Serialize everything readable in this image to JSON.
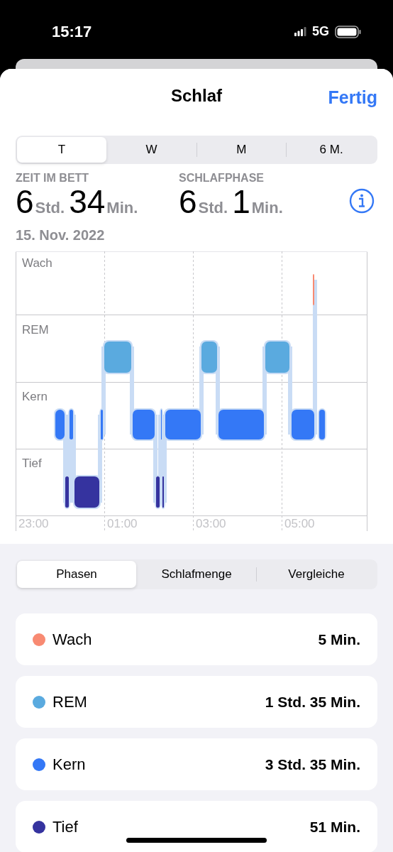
{
  "status_bar": {
    "time": "15:17",
    "network": "5G"
  },
  "header": {
    "title": "Schlaf",
    "done": "Fertig"
  },
  "range_tabs": [
    {
      "label": "T",
      "selected": true
    },
    {
      "label": "W",
      "selected": false
    },
    {
      "label": "M",
      "selected": false
    },
    {
      "label": "6 M.",
      "selected": false
    }
  ],
  "summary": [
    {
      "label": "ZEIT IM BETT",
      "hours": "6",
      "hours_unit": "Std.",
      "minutes": "34",
      "minutes_unit": "Min."
    },
    {
      "label": "SCHLAFPHASE",
      "hours": "6",
      "hours_unit": "Std.",
      "minutes": "1",
      "minutes_unit": "Min."
    }
  ],
  "date": "15. Nov. 2022",
  "chart": {
    "stages": [
      "Wach",
      "REM",
      "Kern",
      "Tief"
    ],
    "times": [
      "23:00",
      "01:00",
      "03:00",
      "05:00"
    ]
  },
  "view_tabs": [
    {
      "label": "Phasen",
      "selected": true
    },
    {
      "label": "Schlafmenge",
      "selected": false
    },
    {
      "label": "Vergleiche",
      "selected": false
    }
  ],
  "phases": [
    {
      "name": "Wach",
      "duration": "5 Min.",
      "color": "#f88a72"
    },
    {
      "name": "REM",
      "duration": "1 Std. 35 Min.",
      "color": "#5aaadf"
    },
    {
      "name": "Kern",
      "duration": "3 Std. 35 Min.",
      "color": "#3478f6"
    },
    {
      "name": "Tief",
      "duration": "51 Min.",
      "color": "#35339f"
    }
  ]
}
